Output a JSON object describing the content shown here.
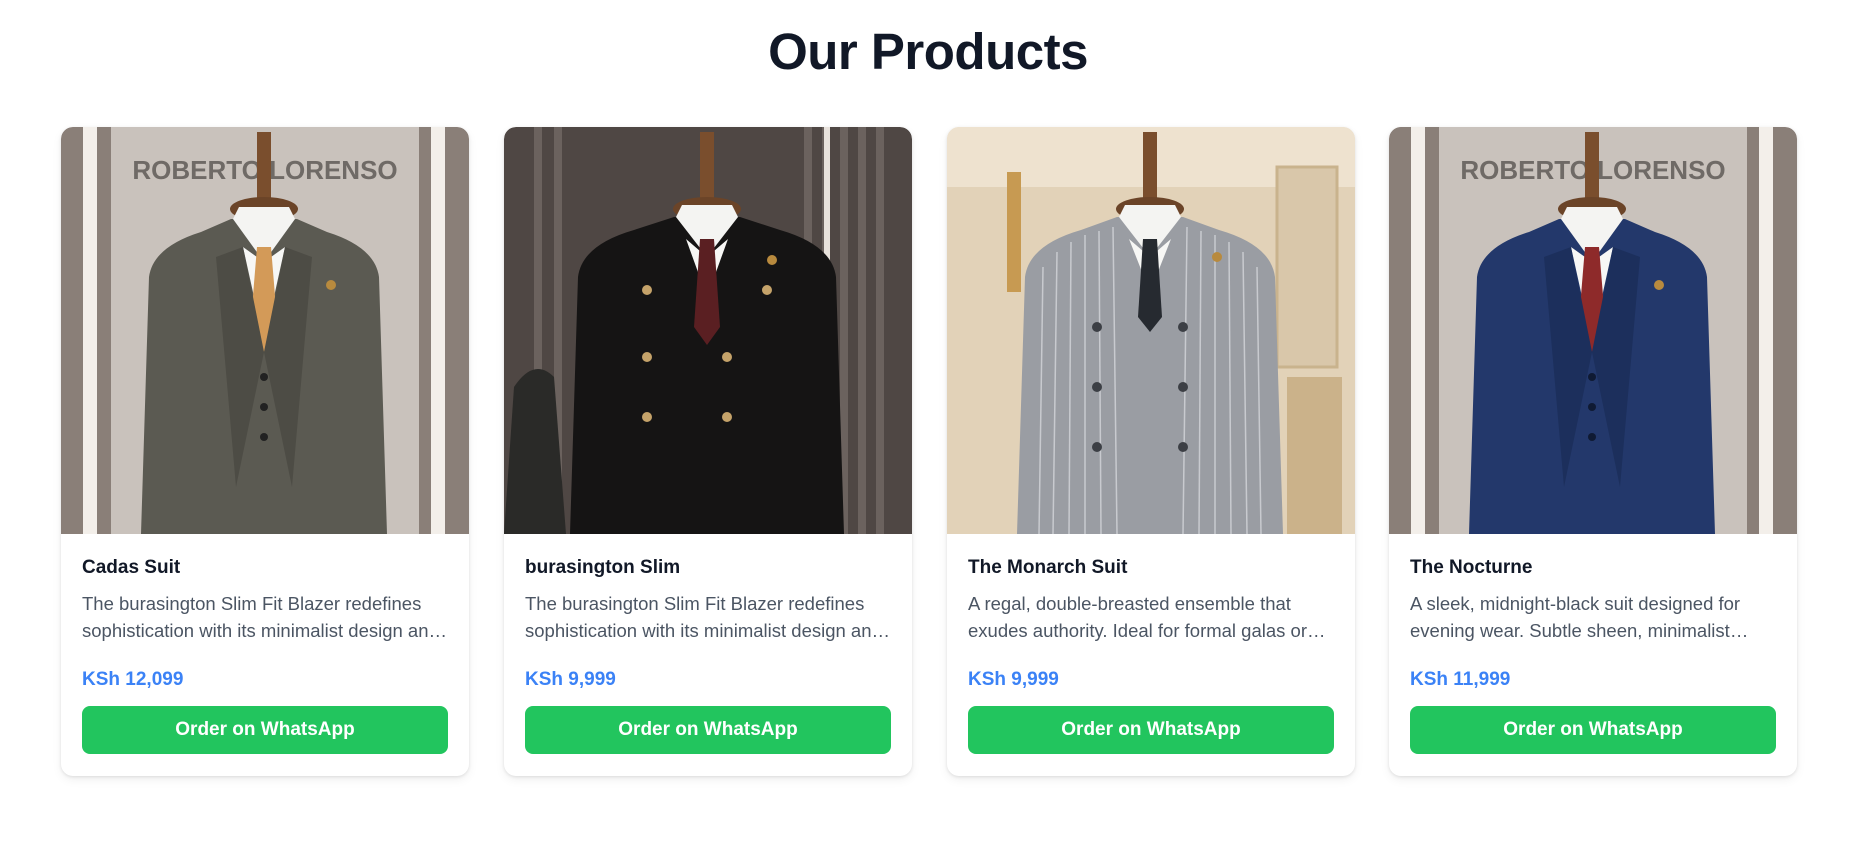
{
  "section": {
    "title": "Our Products"
  },
  "products": [
    {
      "name": "Cadas Suit",
      "description": "The burasington Slim Fit Blazer redefines sophistication with its minimalist design and impeccable tailoring.",
      "price": "KSh 12,099",
      "cta": "Order on WhatsApp",
      "image": "grey-three-piece-suit-on-mannequin",
      "suit_color": "#5b5a52",
      "backdrop_color": "#cfc8c2",
      "store_sign": "ROBERTO LORENSO"
    },
    {
      "name": "burasington Slim",
      "description": "The burasington Slim Fit Blazer redefines sophistication with its minimalist design and impeccable tailoring.",
      "price": "KSh 9,999",
      "cta": "Order on WhatsApp",
      "image": "black-double-breasted-suit-on-mannequin",
      "suit_color": "#151414",
      "backdrop_color": "#5a514d"
    },
    {
      "name": "The Monarch Suit",
      "description": "A regal, double-breasted ensemble that exudes authority. Ideal for formal galas or high-stakes meetings.",
      "price": "KSh 9,999",
      "cta": "Order on WhatsApp",
      "image": "grey-pinstripe-double-breasted-suit-on-mannequin",
      "suit_color": "#9a9da3",
      "backdrop_color": "#e6d6be"
    },
    {
      "name": "The Nocturne",
      "description": "A sleek, midnight-black suit designed for evening wear. Subtle sheen, minimalist lapels for effortless style.",
      "price": "KSh 11,999",
      "cta": "Order on WhatsApp",
      "image": "navy-three-piece-suit-on-mannequin",
      "suit_color": "#23386b",
      "backdrop_color": "#cfc8c2",
      "store_sign": "ROBERTO LORENSO"
    }
  ],
  "colors": {
    "title": "#111827",
    "price": "#3b82f6",
    "button": "#22c55e",
    "description": "#4b5563"
  }
}
